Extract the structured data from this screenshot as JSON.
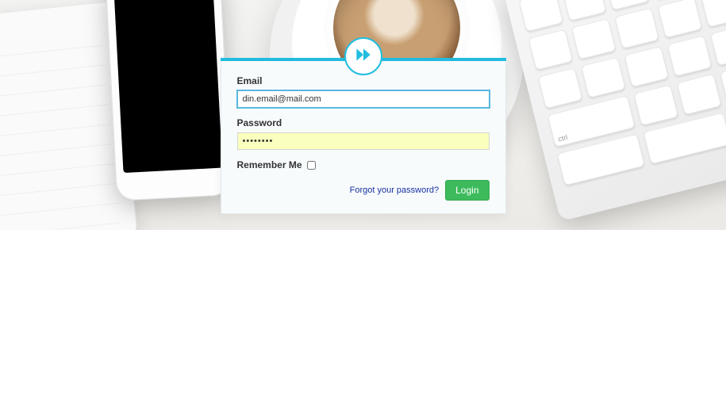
{
  "logo": {
    "icon_name": "fast-forward-icon",
    "color": "#22bde0"
  },
  "form": {
    "email": {
      "label": "Email",
      "value": "din.email@mail.com",
      "placeholder": ""
    },
    "password": {
      "label": "Password",
      "value": "••••••••",
      "placeholder": ""
    },
    "remember": {
      "label": "Remember Me",
      "checked": false
    },
    "forgot_link": "Forgot your password?",
    "login_button": "Login"
  }
}
